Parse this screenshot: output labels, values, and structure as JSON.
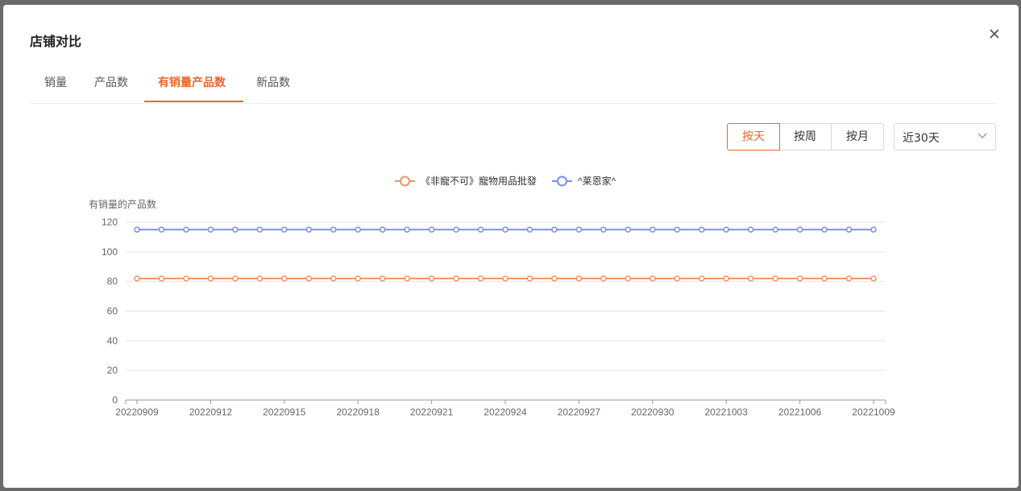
{
  "dialog": {
    "title": "店铺对比",
    "tabs": [
      {
        "label": "销量",
        "active": false
      },
      {
        "label": "产品数",
        "active": false
      },
      {
        "label": "有销量产品数",
        "active": true
      },
      {
        "label": "新品数",
        "active": false
      }
    ],
    "granularity": [
      {
        "label": "按天",
        "active": true
      },
      {
        "label": "按周",
        "active": false
      },
      {
        "label": "按月",
        "active": false
      }
    ],
    "range_select": {
      "value": "近30天"
    },
    "close_icon": "close-icon"
  },
  "colors": {
    "accent": "#e8672a",
    "series1": "#f0956a",
    "series2": "#7b8ff0"
  },
  "chart_data": {
    "type": "line",
    "ylabel": "有销量的产品数",
    "ylim": [
      0,
      120
    ],
    "yticks": [
      0,
      20,
      40,
      60,
      80,
      100,
      120
    ],
    "x": [
      "20220909",
      "20220910",
      "20220911",
      "20220912",
      "20220913",
      "20220914",
      "20220915",
      "20220916",
      "20220917",
      "20220918",
      "20220919",
      "20220920",
      "20220921",
      "20220922",
      "20220923",
      "20220924",
      "20220925",
      "20220926",
      "20220927",
      "20220928",
      "20220929",
      "20220930",
      "20221001",
      "20221002",
      "20221003",
      "20221004",
      "20221005",
      "20221006",
      "20221007",
      "20221008",
      "20221009"
    ],
    "xtick_labels": [
      "20220909",
      "20220912",
      "20220915",
      "20220918",
      "20220921",
      "20220924",
      "20220927",
      "20220930",
      "20221003",
      "20221006",
      "20221009"
    ],
    "series": [
      {
        "name": "《非寵不可》寵物用品批發",
        "color": "#f0956a",
        "values": [
          82,
          82,
          82,
          82,
          82,
          82,
          82,
          82,
          82,
          82,
          82,
          82,
          82,
          82,
          82,
          82,
          82,
          82,
          82,
          82,
          82,
          82,
          82,
          82,
          82,
          82,
          82,
          82,
          82,
          82,
          82
        ]
      },
      {
        "name": "^莱恩家^",
        "color": "#7b8ff0",
        "values": [
          115,
          115,
          115,
          115,
          115,
          115,
          115,
          115,
          115,
          115,
          115,
          115,
          115,
          115,
          115,
          115,
          115,
          115,
          115,
          115,
          115,
          115,
          115,
          115,
          115,
          115,
          115,
          115,
          115,
          115,
          115
        ]
      }
    ],
    "legend_position": "top-center",
    "grid": true
  }
}
